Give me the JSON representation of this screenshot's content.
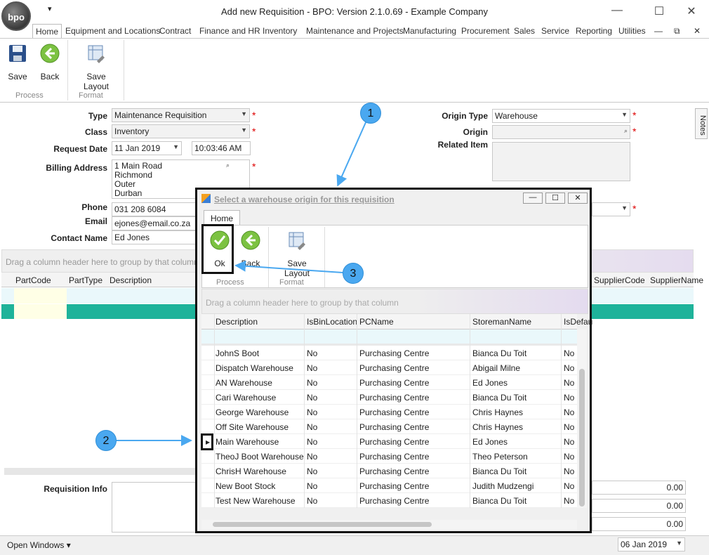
{
  "window": {
    "title": "Add new Requisition - BPO: Version 2.1.0.69 - Example Company",
    "logo_text": "bpo"
  },
  "tabs": [
    "Home",
    "Equipment and Locations",
    "Contract",
    "Finance and HR",
    "Inventory",
    "Maintenance and Projects",
    "Manufacturing",
    "Procurement",
    "Sales",
    "Service",
    "Reporting",
    "Utilities"
  ],
  "ribbon": {
    "save": "Save",
    "back": "Back",
    "save_layout": "Save Layout",
    "group_process": "Process",
    "group_format": "Format"
  },
  "form": {
    "type_label": "Type",
    "type_value": "Maintenance Requisition",
    "class_label": "Class",
    "class_value": "Inventory",
    "request_date_label": "Request Date",
    "request_date_value": "11 Jan 2019",
    "request_time_value": "10:03:46 AM",
    "billing_label": "Billing Address",
    "billing_lines": [
      "1 Main Road",
      "Richmond",
      "Outer",
      "Durban"
    ],
    "phone_label": "Phone",
    "phone_value": "031 208 6084",
    "email_label": "Email",
    "email_value": "ejones@email.co.za",
    "contact_label": "Contact Name",
    "contact_value": "Ed Jones",
    "origin_type_label": "Origin Type",
    "origin_type_value": "Warehouse",
    "origin_label": "Origin",
    "related_item_label": "Related Item",
    "req_info_label": "Requisition Info",
    "totals": [
      "0.00",
      "0.00",
      "0.00"
    ]
  },
  "bg_grid": {
    "group_hint": "Drag a column header here to group by that column",
    "columns": [
      "PartCode",
      "PartType",
      "Description",
      "SupplierCode",
      "SupplierName"
    ]
  },
  "notes_tab": "Notes",
  "dialog": {
    "title": "Select a warehouse origin for this requisition",
    "tab": "Home",
    "ok": "Ok",
    "back": "Back",
    "save_layout": "Save Layout",
    "group_process": "Process",
    "group_format": "Format",
    "group_hint": "Drag a column header here to group by that column",
    "columns": [
      "Description",
      "IsBinLocation",
      "PCName",
      "StoremanName",
      "IsDefau"
    ],
    "rows": [
      [
        "JohnS Boot",
        "No",
        "Purchasing Centre",
        "Bianca Du Toit",
        "No"
      ],
      [
        "Dispatch Warehouse",
        "No",
        "Purchasing Centre",
        "Abigail Milne",
        "No"
      ],
      [
        "AN Warehouse",
        "No",
        "Purchasing Centre",
        "Ed Jones",
        "No"
      ],
      [
        "Cari Warehouse",
        "No",
        "Purchasing Centre",
        "Bianca Du Toit",
        "No"
      ],
      [
        "George Warehouse",
        "No",
        "Purchasing Centre",
        "Chris Haynes",
        "No"
      ],
      [
        "Off Site Warehouse",
        "No",
        "Purchasing Centre",
        "Chris Haynes",
        "No"
      ],
      [
        "Main Warehouse",
        "No",
        "Purchasing Centre",
        "Ed Jones",
        "No"
      ],
      [
        "TheoJ Boot Warehouse",
        "No",
        "Purchasing Centre",
        "Theo Peterson",
        "No"
      ],
      [
        "ChrisH Warehouse",
        "No",
        "Purchasing Centre",
        "Bianca Du Toit",
        "No"
      ],
      [
        "New Boot Stock",
        "No",
        "Purchasing Centre",
        "Judith Mudzengi",
        "No"
      ],
      [
        "Test New Warehouse",
        "No",
        "Purchasing Centre",
        "Bianca Du Toit",
        "No"
      ]
    ]
  },
  "callouts": [
    "1",
    "2",
    "3"
  ],
  "status": {
    "open_windows": "Open Windows",
    "date": "06 Jan 2019"
  },
  "colors": {
    "accent_teal": "#1eb39a",
    "callout_blue": "#4aa8f0",
    "required_red": "#dd0000"
  }
}
